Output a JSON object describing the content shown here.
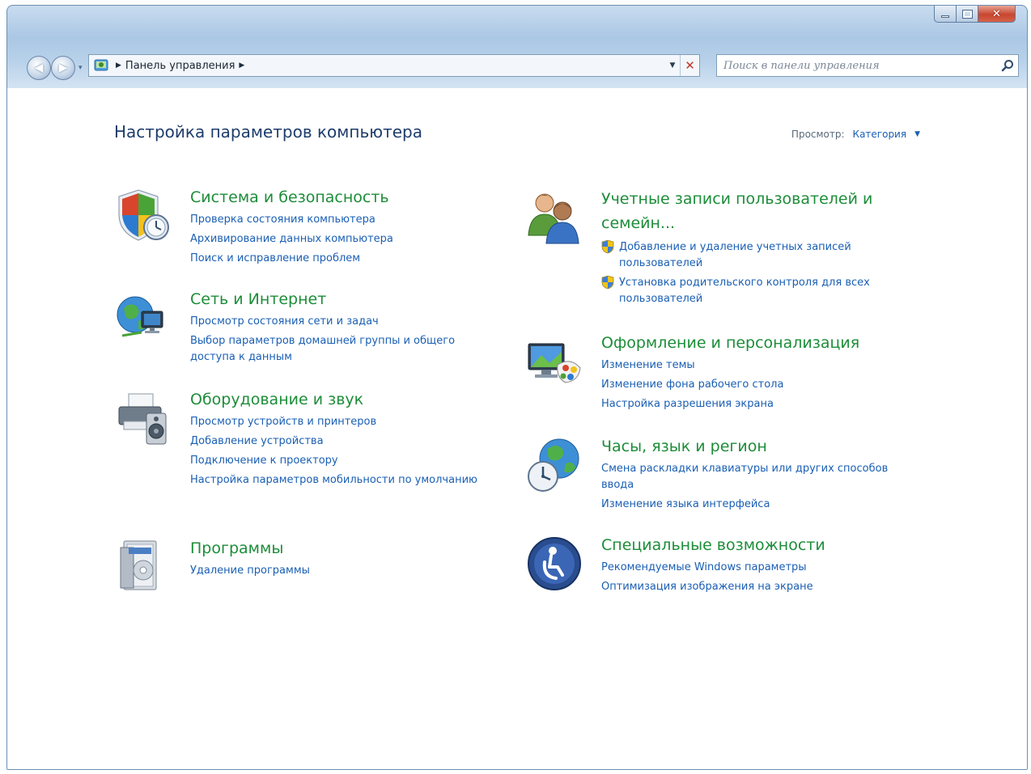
{
  "window": {
    "controls": {
      "minimize": "minimize",
      "maximize": "maximize",
      "close": "✕"
    }
  },
  "navbar": {
    "back_glyph": "◀",
    "forward_glyph": "▶",
    "recent_glyph": "▾",
    "address": {
      "breadcrumb": "Панель управления",
      "arrow_before": "▶",
      "arrow_after": "▶",
      "dropdown_glyph": "▼",
      "refresh_glyph": "✕"
    },
    "search": {
      "placeholder": "Поиск в панели управления"
    }
  },
  "header": {
    "title": "Настройка параметров компьютера",
    "view_label": "Просмотр:",
    "view_value": "Категория",
    "view_arrow": "▼"
  },
  "left_categories": [
    {
      "title": "Система и безопасность",
      "icon": "shield-clock-icon",
      "links": [
        "Проверка состояния компьютера",
        "Архивирование данных компьютера",
        "Поиск и исправление проблем"
      ]
    },
    {
      "title": "Сеть и Интернет",
      "icon": "globe-network-icon",
      "links": [
        "Просмотр состояния сети и задач",
        "Выбор параметров домашней группы и общего доступа к данным"
      ]
    },
    {
      "title": "Оборудование и звук",
      "icon": "printer-speaker-icon",
      "links": [
        "Просмотр устройств и принтеров",
        "Добавление устройства",
        "Подключение к проектору",
        "Настройка параметров мобильности по умолчанию"
      ]
    },
    {
      "title": "Программы",
      "icon": "programs-box-icon",
      "links": [
        "Удаление программы"
      ]
    }
  ],
  "right_categories": [
    {
      "title": "Учетные записи пользователей и семейн...",
      "icon": "users-icon",
      "links": [
        "Добавление и удаление учетных записей пользователей",
        "Установка родительского контроля для всех пользователей"
      ]
    },
    {
      "title": "Оформление и персонализация",
      "icon": "monitor-palette-icon",
      "links": [
        "Изменение темы",
        "Изменение фона рабочего стола",
        "Настройка разрешения экрана"
      ]
    },
    {
      "title": "Часы, язык и регион",
      "icon": "clock-globe-icon",
      "links": [
        "Смена раскладки клавиатуры или других способов ввода",
        "Изменение языка интерфейса"
      ]
    },
    {
      "title": "Специальные возможности",
      "icon": "accessibility-icon",
      "links": [
        "Рекомендуемые Windows параметры",
        "Оптимизация изображения на экране"
      ]
    }
  ],
  "colors": {
    "category_title": "#1d8d39",
    "link": "#1a5fb4",
    "page_title": "#1e3d6c"
  }
}
